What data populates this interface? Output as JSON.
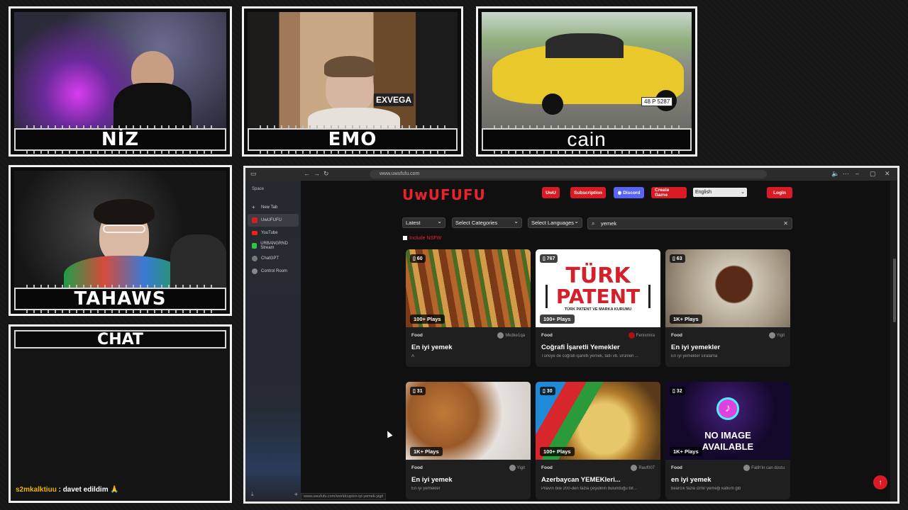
{
  "streams": {
    "cam1": {
      "name": "NİZ"
    },
    "cam2": {
      "name": "EMO",
      "shirt_text": "EXVEGA"
    },
    "cam3": {
      "name": "cain",
      "plate": "48 P 5287"
    },
    "cam4": {
      "name": "TAHAWS"
    }
  },
  "chat": {
    "title": "CHAT",
    "message_user": "s2mkalktiuu",
    "message_text": " : davet edildim 🙏"
  },
  "browser": {
    "address": "www.uwufufu.com",
    "sidebar": {
      "space_label": "Space",
      "items": [
        {
          "label": "New Tab",
          "icon": "plus-icon"
        },
        {
          "label": "UwUFUFU",
          "icon": "uwufufu-icon"
        },
        {
          "label": "YouTube",
          "icon": "youtube-icon"
        },
        {
          "label": "URBANGRND Stream",
          "icon": "kick-icon"
        },
        {
          "label": "ChatGPT",
          "icon": "chatgpt-icon"
        },
        {
          "label": "Control Room",
          "icon": "control-icon"
        }
      ]
    },
    "status_url": "www.uwufufu.com/worldcup/en-iyi-yemek-yigit"
  },
  "site": {
    "logo": "UwUFUFU",
    "nav": {
      "uwu": "UwU",
      "subscription": "Subscription",
      "discord": "Discord",
      "create_game": "Create Game",
      "language": "English",
      "login": "Login"
    },
    "filters": {
      "sort": "Latest",
      "categories": "Select Categories",
      "languages": "Select Languages",
      "search_value": "yemek",
      "nsfw_label": "Include NSFW"
    },
    "cards": [
      {
        "count": "60",
        "plays": "100+ Plays",
        "category": "Food",
        "author": "Mkdke1qa",
        "title": "En iyi yemek",
        "desc": "A"
      },
      {
        "count": "767",
        "plays": "100+ Plays",
        "category": "Food",
        "author": "Fenixmira",
        "title": "Coğrafi İşaretli Yemekler",
        "desc": "Türkiye de coğrafi işaretli yemek, tatlı vb. ürünleri ..."
      },
      {
        "count": "63",
        "plays": "1K+ Plays",
        "category": "Food",
        "author": "Yigit",
        "title": "En iyi yemekler",
        "desc": "En iyi yemekler sıralama"
      },
      {
        "count": "31",
        "plays": "1K+ Plays",
        "category": "Food",
        "author": "Yigit",
        "title": "En iyi yemek",
        "desc": "En iyi yemekler"
      },
      {
        "count": "30",
        "plays": "100+ Plays",
        "category": "Food",
        "author": "Rauf007",
        "title": "Azerbaycan YEMEKleri...",
        "desc": "Pilavın bile 200-den fazla çeşidinin bulunduğu bir..."
      },
      {
        "count": "32",
        "plays": "1K+ Plays",
        "category": "Food",
        "author": "Fatih'in can dostu",
        "title": "en iyi yemek",
        "desc": "bearcık fazla izmir yemeği katkım gib"
      }
    ],
    "patent_text_1": "TÜRK",
    "patent_text_2": "PATENT",
    "patent_sub": "TÜRK PATENT VE MARKA KURUMU",
    "noimage_1": "NO IMAGE",
    "noimage_2": "AVAILABLE"
  }
}
